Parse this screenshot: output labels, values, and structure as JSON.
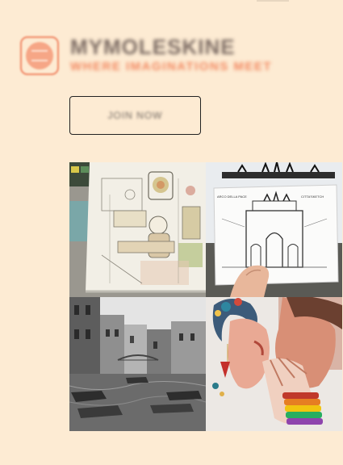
{
  "brand": {
    "name": "MYMOLESKINE",
    "tagline": "WHERE IMAGINATIONS MEET"
  },
  "cta": {
    "join_label": "JOIN NOW"
  },
  "gallery": {
    "images": [
      {
        "alt": "Sketchbook drawing of an artist's room"
      },
      {
        "alt": "Sketchbook drawing of a triumphal arch"
      },
      {
        "alt": "Black and white photo of a canal town"
      },
      {
        "alt": "Painting of a couple kissing"
      }
    ],
    "arch_caption_left": "ARCO DELLA PACE",
    "arch_caption_right": "CITTA'SKETCH"
  },
  "colors": {
    "background": "#fdebd3",
    "accent": "#f08461",
    "button_border": "#222222"
  }
}
